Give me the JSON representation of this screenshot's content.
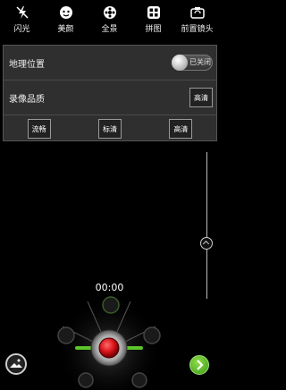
{
  "toolbar": {
    "items": [
      {
        "label": "闪光",
        "icon": "flash-off-icon"
      },
      {
        "label": "美颜",
        "icon": "beauty-icon"
      },
      {
        "label": "全景",
        "icon": "panorama-icon"
      },
      {
        "label": "拼图",
        "icon": "collage-icon"
      },
      {
        "label": "前置镜头",
        "icon": "switch-camera-icon"
      }
    ]
  },
  "settings": {
    "location_label": "地理位置",
    "location_toggle_text": "已关闭",
    "quality_label": "录像品质",
    "quality_current": "高清",
    "options": [
      "流畅",
      "标清",
      "高清"
    ]
  },
  "recording": {
    "timer": "00:00"
  },
  "colors": {
    "panel_bg": "#2f2f2f",
    "record_red": "#d8121a",
    "accent_green": "#5cc62a"
  }
}
